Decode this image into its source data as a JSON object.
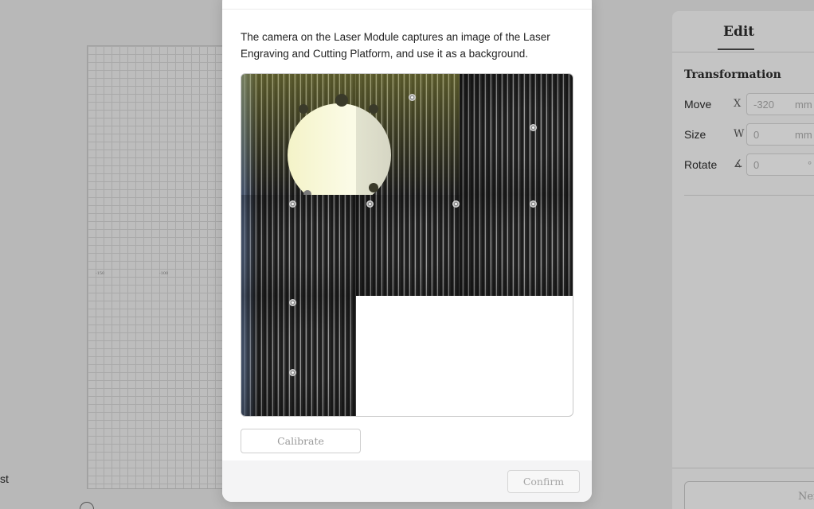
{
  "workspace": {
    "axis_labels": [
      "-150",
      "-100"
    ],
    "bottom_text": "st"
  },
  "right_panel": {
    "tab_label": "Edit",
    "section_title": "Transformation",
    "rows": [
      {
        "label": "Move",
        "axis": "X",
        "value": "-320",
        "unit": "mm"
      },
      {
        "label": "Size",
        "axis": "W",
        "value": "0",
        "unit": "mm"
      },
      {
        "label": "Rotate",
        "axis": "∡",
        "value": "0",
        "unit": "°"
      }
    ],
    "next_label": "Nex"
  },
  "modal": {
    "description": "The camera on the Laser Module captures an image of the Laser Engraving and Cutting Platform, and use it as a background.",
    "calibrate_label": "Calibrate",
    "confirm_label": "Confirm"
  }
}
